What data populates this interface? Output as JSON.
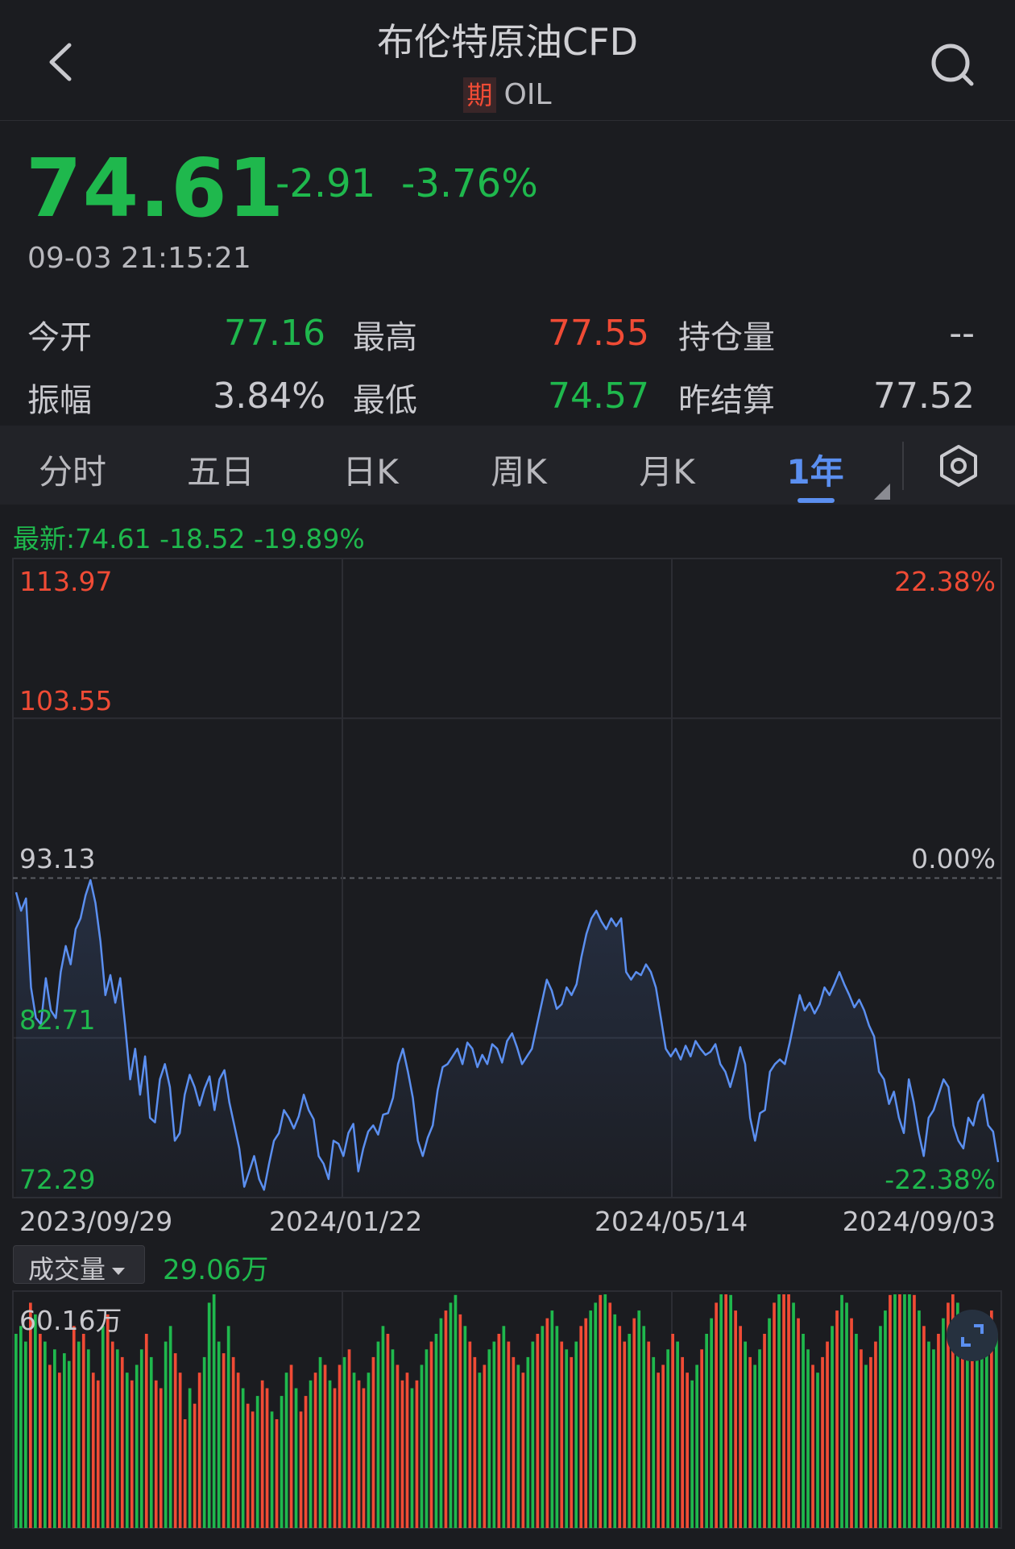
{
  "header": {
    "title": "布伦特原油CFD",
    "badge": "期",
    "code": "OIL",
    "back_icon": "chevron-left-icon",
    "search_icon": "search-icon"
  },
  "quote": {
    "price": "74.61",
    "change": "-2.91",
    "change_pct": "-3.76%",
    "time": "09-03 21:15:21"
  },
  "stats": [
    {
      "label": "今开",
      "value": "77.16",
      "color": "#1fb84d"
    },
    {
      "label": "最高",
      "value": "77.55",
      "color": "#f04b35"
    },
    {
      "label": "持仓量",
      "value": "--",
      "color": "#c9c9ce"
    },
    {
      "label": "振幅",
      "value": "3.84%",
      "color": "#c9c9ce"
    },
    {
      "label": "最低",
      "value": "74.57",
      "color": "#1fb84d"
    },
    {
      "label": "昨结算",
      "value": "77.52",
      "color": "#c9c9ce"
    }
  ],
  "tabs": [
    {
      "label": "分时"
    },
    {
      "label": "五日"
    },
    {
      "label": "日K"
    },
    {
      "label": "周K"
    },
    {
      "label": "月K"
    },
    {
      "label": "1年",
      "active": true
    }
  ],
  "chart_stats": "最新:74.61  -18.52  -19.89%",
  "chart_data": {
    "type": "line",
    "y_labels_left": [
      "113.97",
      "103.55",
      "93.13",
      "82.71",
      "72.29"
    ],
    "y_labels_right": [
      "22.38%",
      "0.00%",
      "-22.38%"
    ],
    "ylim": [
      72.29,
      113.97
    ],
    "baseline": 93.13,
    "x_labels": [
      "2023/09/29",
      "2024/01/22",
      "2024/05/14",
      "2024/09/03"
    ],
    "values": [
      92.2,
      91.0,
      91.8,
      86.0,
      84.0,
      83.6,
      86.6,
      84.5,
      84.0,
      87.0,
      88.7,
      87.5,
      89.8,
      90.5,
      92.0,
      93.0,
      91.5,
      89.0,
      85.5,
      86.8,
      85.0,
      86.6,
      83.5,
      80.0,
      82.0,
      79.0,
      81.5,
      77.5,
      77.2,
      80.0,
      81.0,
      79.5,
      76.0,
      76.5,
      79.0,
      80.3,
      79.5,
      78.3,
      79.4,
      80.2,
      78.0,
      80.0,
      80.6,
      78.5,
      77.0,
      75.5,
      73.0,
      74.0,
      75.0,
      73.5,
      72.8,
      74.5,
      76.0,
      76.5,
      78.0,
      77.5,
      76.8,
      77.6,
      79.0,
      78.0,
      77.4,
      75.0,
      74.5,
      73.5,
      76.0,
      75.8,
      75.0,
      76.5,
      77.1,
      74.0,
      75.5,
      76.6,
      77.0,
      76.4,
      77.7,
      77.8,
      78.8,
      81.0,
      82.0,
      80.5,
      78.8,
      76.0,
      75.0,
      76.2,
      77.0,
      79.3,
      80.8,
      81.0,
      81.5,
      82.0,
      81.0,
      82.4,
      82.0,
      80.8,
      81.6,
      81.0,
      82.3,
      82.0,
      81.1,
      82.5,
      83.0,
      82.1,
      81.0,
      81.5,
      82.0,
      83.5,
      85.0,
      86.5,
      85.8,
      84.6,
      84.9,
      86.0,
      85.5,
      86.2,
      88.0,
      89.5,
      90.5,
      91.0,
      90.3,
      89.8,
      90.5,
      90.0,
      90.5,
      87.0,
      86.5,
      87.0,
      86.8,
      87.5,
      87.0,
      86.0,
      84.0,
      82.0,
      81.5,
      82.0,
      81.3,
      82.2,
      81.5,
      82.5,
      82.0,
      81.6,
      81.8,
      82.3,
      81.0,
      80.5,
      79.5,
      80.7,
      82.1,
      81.0,
      77.5,
      76.0,
      77.8,
      78.0,
      80.5,
      81.0,
      81.3,
      81.0,
      82.4,
      84.0,
      85.5,
      84.5,
      85.0,
      84.3,
      84.9,
      86.0,
      85.5,
      86.2,
      87.0,
      86.2,
      85.5,
      84.7,
      85.2,
      84.5,
      83.5,
      82.8,
      80.5,
      80.0,
      78.4,
      79.2,
      77.5,
      76.5,
      80.0,
      78.5,
      76.5,
      75.0,
      77.5,
      78.0,
      79.0,
      80.0,
      79.5,
      77.0,
      76.0,
      75.5,
      77.5,
      77.0,
      78.5,
      79.0,
      77.0,
      76.6,
      74.61
    ],
    "volume": [
      0.5,
      0.52,
      0.48,
      0.58,
      0.55,
      0.5,
      0.48,
      0.42,
      0.46,
      0.4,
      0.45,
      0.43,
      0.52,
      0.48,
      0.5,
      0.46,
      0.4,
      0.38,
      0.52,
      0.55,
      0.48,
      0.46,
      0.44,
      0.4,
      0.38,
      0.42,
      0.46,
      0.5,
      0.44,
      0.38,
      0.36,
      0.48,
      0.52,
      0.45,
      0.4,
      0.28,
      0.36,
      0.32,
      0.4,
      0.44,
      0.58,
      0.82,
      0.48,
      0.45,
      0.52,
      0.44,
      0.4,
      0.36,
      0.32,
      0.3,
      0.34,
      0.38,
      0.36,
      0.3,
      0.28,
      0.34,
      0.4,
      0.42,
      0.36,
      0.3,
      0.34,
      0.38,
      0.4,
      0.44,
      0.42,
      0.38,
      0.36,
      0.42,
      0.44,
      0.46,
      0.4,
      0.38,
      0.36,
      0.4,
      0.44,
      0.48,
      0.52,
      0.5,
      0.46,
      0.42,
      0.38,
      0.4,
      0.36,
      0.38,
      0.42,
      0.46,
      0.48,
      0.5,
      0.54,
      0.56,
      0.58,
      0.6,
      0.55,
      0.52,
      0.48,
      0.44,
      0.4,
      0.42,
      0.46,
      0.48,
      0.5,
      0.52,
      0.48,
      0.44,
      0.42,
      0.4,
      0.44,
      0.48,
      0.5,
      0.52,
      0.54,
      0.56,
      0.52,
      0.48,
      0.46,
      0.44,
      0.48,
      0.52,
      0.54,
      0.56,
      0.58,
      0.6,
      0.62,
      0.58,
      0.55,
      0.52,
      0.48,
      0.5,
      0.54,
      0.56,
      0.52,
      0.48,
      0.44,
      0.4,
      0.42,
      0.46,
      0.5,
      0.48,
      0.44,
      0.4,
      0.38,
      0.42,
      0.46,
      0.5,
      0.54,
      0.58,
      0.62,
      0.64,
      0.6,
      0.56,
      0.52,
      0.48,
      0.44,
      0.42,
      0.46,
      0.5,
      0.54,
      0.58,
      0.62,
      0.66,
      0.62,
      0.58,
      0.54,
      0.5,
      0.46,
      0.42,
      0.4,
      0.44,
      0.48,
      0.52,
      0.56,
      0.6,
      0.58,
      0.54,
      0.5,
      0.46,
      0.42,
      0.44,
      0.48,
      0.52,
      0.56,
      0.6,
      0.64,
      0.68,
      0.72,
      0.66,
      0.6,
      0.56,
      0.52,
      0.48,
      0.46,
      0.5,
      0.54,
      0.58,
      0.62,
      0.58,
      0.54,
      0.5,
      0.46,
      0.44,
      0.48,
      0.52,
      0.56,
      0.5
    ],
    "vol_up": [
      1,
      1,
      1,
      0,
      1,
      0,
      1,
      0,
      1,
      0,
      1,
      1,
      0,
      1,
      0,
      1,
      0,
      0,
      1,
      0,
      0,
      1,
      0,
      1,
      0,
      1,
      1,
      0,
      1,
      0,
      0,
      1,
      1,
      0,
      0,
      0,
      1,
      0,
      0,
      1,
      1,
      1,
      1,
      0,
      1,
      0,
      0,
      1,
      0,
      0,
      1,
      0,
      0,
      1,
      0,
      1,
      1,
      0,
      1,
      0,
      0,
      1,
      0,
      1,
      0,
      1,
      0,
      0,
      1,
      0,
      1,
      0,
      0,
      1,
      0,
      1,
      1,
      0,
      1,
      0,
      0,
      0,
      1,
      0,
      1,
      1,
      0,
      1,
      1,
      0,
      1,
      1,
      0,
      1,
      0,
      0,
      1,
      0,
      1,
      1,
      0,
      1,
      0,
      0,
      1,
      0,
      1,
      1,
      0,
      1,
      0,
      1,
      1,
      0,
      1,
      0,
      1,
      0,
      0,
      1,
      1,
      0,
      1,
      0,
      1,
      0,
      0,
      1,
      0,
      1,
      1,
      0,
      1,
      0,
      0,
      1,
      0,
      1,
      0,
      0,
      1,
      1,
      0,
      1,
      1,
      0,
      1,
      0,
      1,
      0,
      0,
      1,
      0,
      1,
      1,
      0,
      1,
      0,
      1,
      0,
      0,
      1,
      0,
      1,
      1,
      0,
      1,
      0,
      0,
      1,
      0,
      1,
      1,
      0,
      1,
      0,
      1,
      0,
      0,
      1,
      1,
      0,
      1,
      0,
      1,
      1,
      0,
      1,
      0,
      1,
      1,
      0,
      1,
      0,
      0,
      1,
      0,
      1,
      0
    ]
  },
  "volume": {
    "label": "成交量",
    "value": "29.06万",
    "max_label": "60.16万",
    "expand_icon": "expand-icon"
  },
  "colors": {
    "up": "#f04b35",
    "down": "#1fb84d",
    "line": "#5b8ff0",
    "grid": "#2c2d33"
  }
}
